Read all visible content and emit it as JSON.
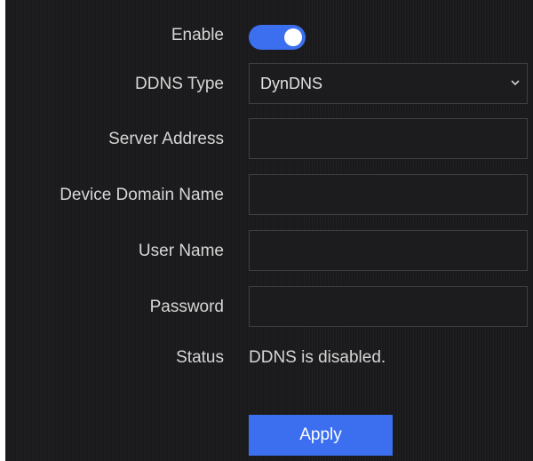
{
  "form": {
    "enable": {
      "label": "Enable",
      "value": true
    },
    "ddns_type": {
      "label": "DDNS Type",
      "value": "DynDNS"
    },
    "server_address": {
      "label": "Server Address",
      "value": ""
    },
    "device_domain_name": {
      "label": "Device Domain Name",
      "value": ""
    },
    "user_name": {
      "label": "User Name",
      "value": ""
    },
    "password": {
      "label": "Password",
      "value": ""
    },
    "status": {
      "label": "Status",
      "value": "DDNS is disabled."
    }
  },
  "apply_label": "Apply",
  "colors": {
    "accent": "#3b6ff0",
    "background": "#1a1a1c",
    "field_border": "#3e3e42",
    "text": "#d6d6d6"
  }
}
